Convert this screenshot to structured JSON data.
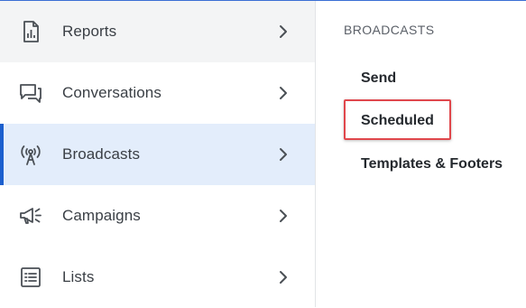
{
  "sidebar": {
    "items": [
      {
        "label": "Reports",
        "icon": "reports-icon"
      },
      {
        "label": "Conversations",
        "icon": "conversations-icon"
      },
      {
        "label": "Broadcasts",
        "icon": "broadcast-icon",
        "active": true
      },
      {
        "label": "Campaigns",
        "icon": "megaphone-icon"
      },
      {
        "label": "Lists",
        "icon": "list-icon"
      }
    ]
  },
  "submenu": {
    "title": "BROADCASTS",
    "items": [
      {
        "label": "Send"
      },
      {
        "label": "Scheduled",
        "highlighted": true
      },
      {
        "label": "Templates & Footers"
      }
    ]
  },
  "colors": {
    "accent": "#1b5fce",
    "active_bg": "#e3edfb",
    "highlight_border": "#e0474c",
    "text": "#3a3f45"
  }
}
